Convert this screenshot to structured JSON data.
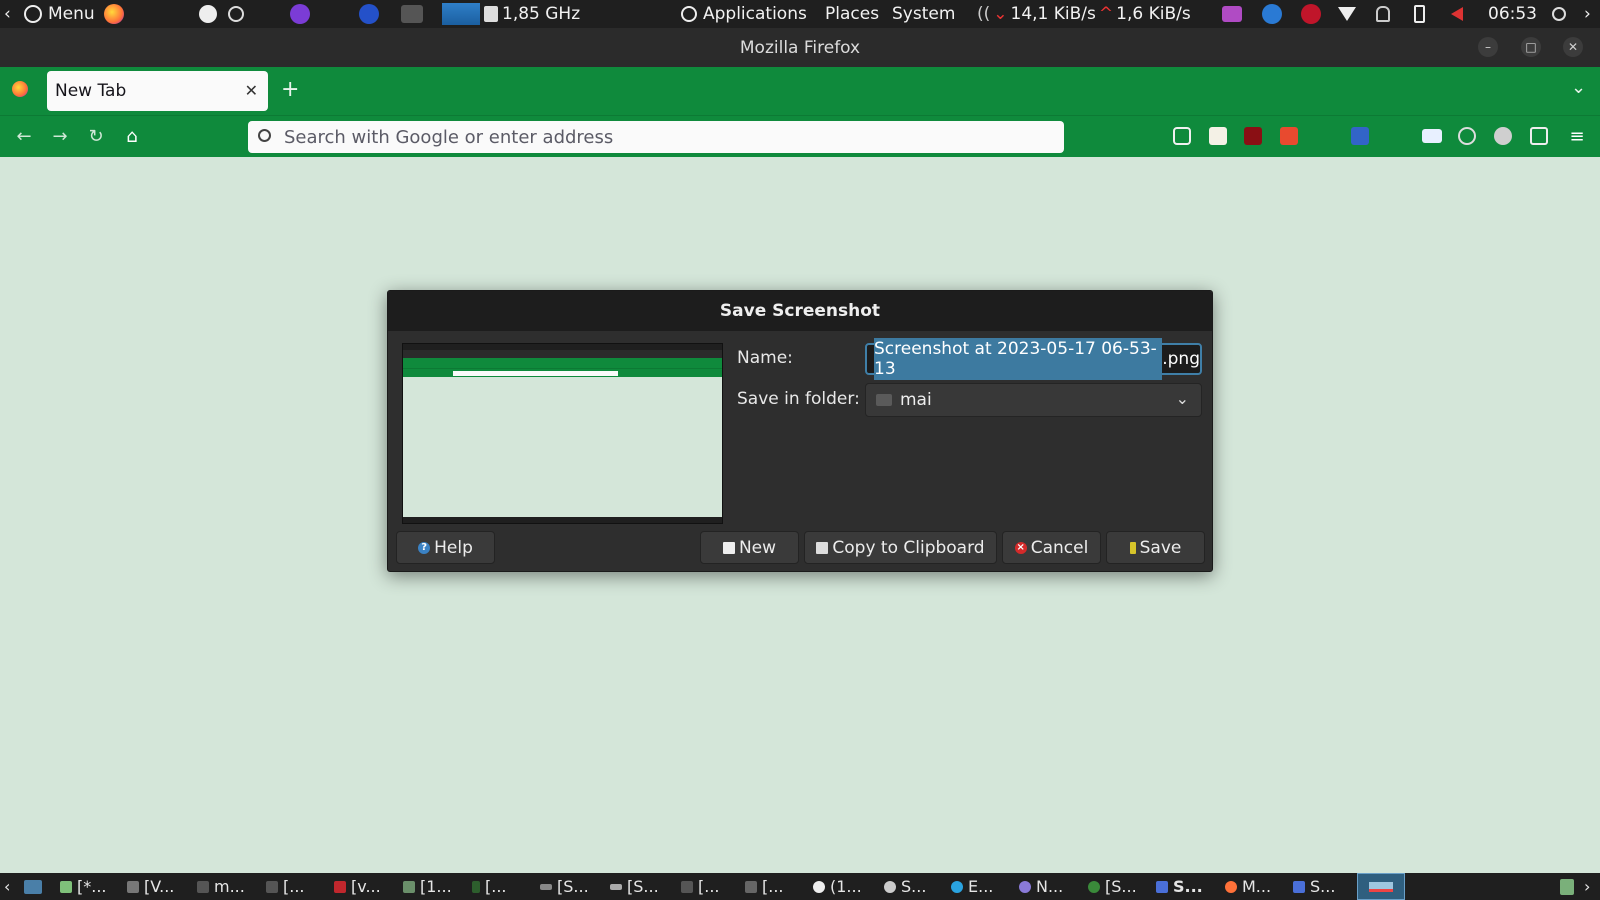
{
  "top_panel": {
    "menu_label": "Menu",
    "cpu_freq": "1,85 GHz",
    "applications_label": "Applications",
    "places_label": "Places",
    "system_label": "System",
    "net_down": "14,1 KiB/s",
    "net_up": "1,6 KiB/s",
    "clock": "06:53"
  },
  "window": {
    "title": "Mozilla Firefox"
  },
  "browser": {
    "tab_title": "New Tab",
    "url_placeholder": "Search with Google or enter address",
    "accent_color": "#0f8a3c"
  },
  "dialog": {
    "title": "Save Screenshot",
    "name_label": "Name:",
    "name_value_selected": "Screenshot at 2023-05-17 06-53-13",
    "name_value_ext": ".png",
    "folder_label": "Save in folder:",
    "folder_value": "mai",
    "buttons": {
      "help": "Help",
      "new": "New",
      "copy": "Copy to Clipboard",
      "cancel": "Cancel",
      "save": "Save"
    }
  },
  "taskbar": {
    "items": [
      "[*...",
      "[V...",
      "m...",
      "[...",
      "[v...",
      "[1...",
      "[...",
      "[S...",
      "[S...",
      "[...",
      "[...",
      "(1...",
      "S...",
      "E...",
      "N...",
      "[S...",
      "S...",
      "M...",
      "S..."
    ]
  }
}
